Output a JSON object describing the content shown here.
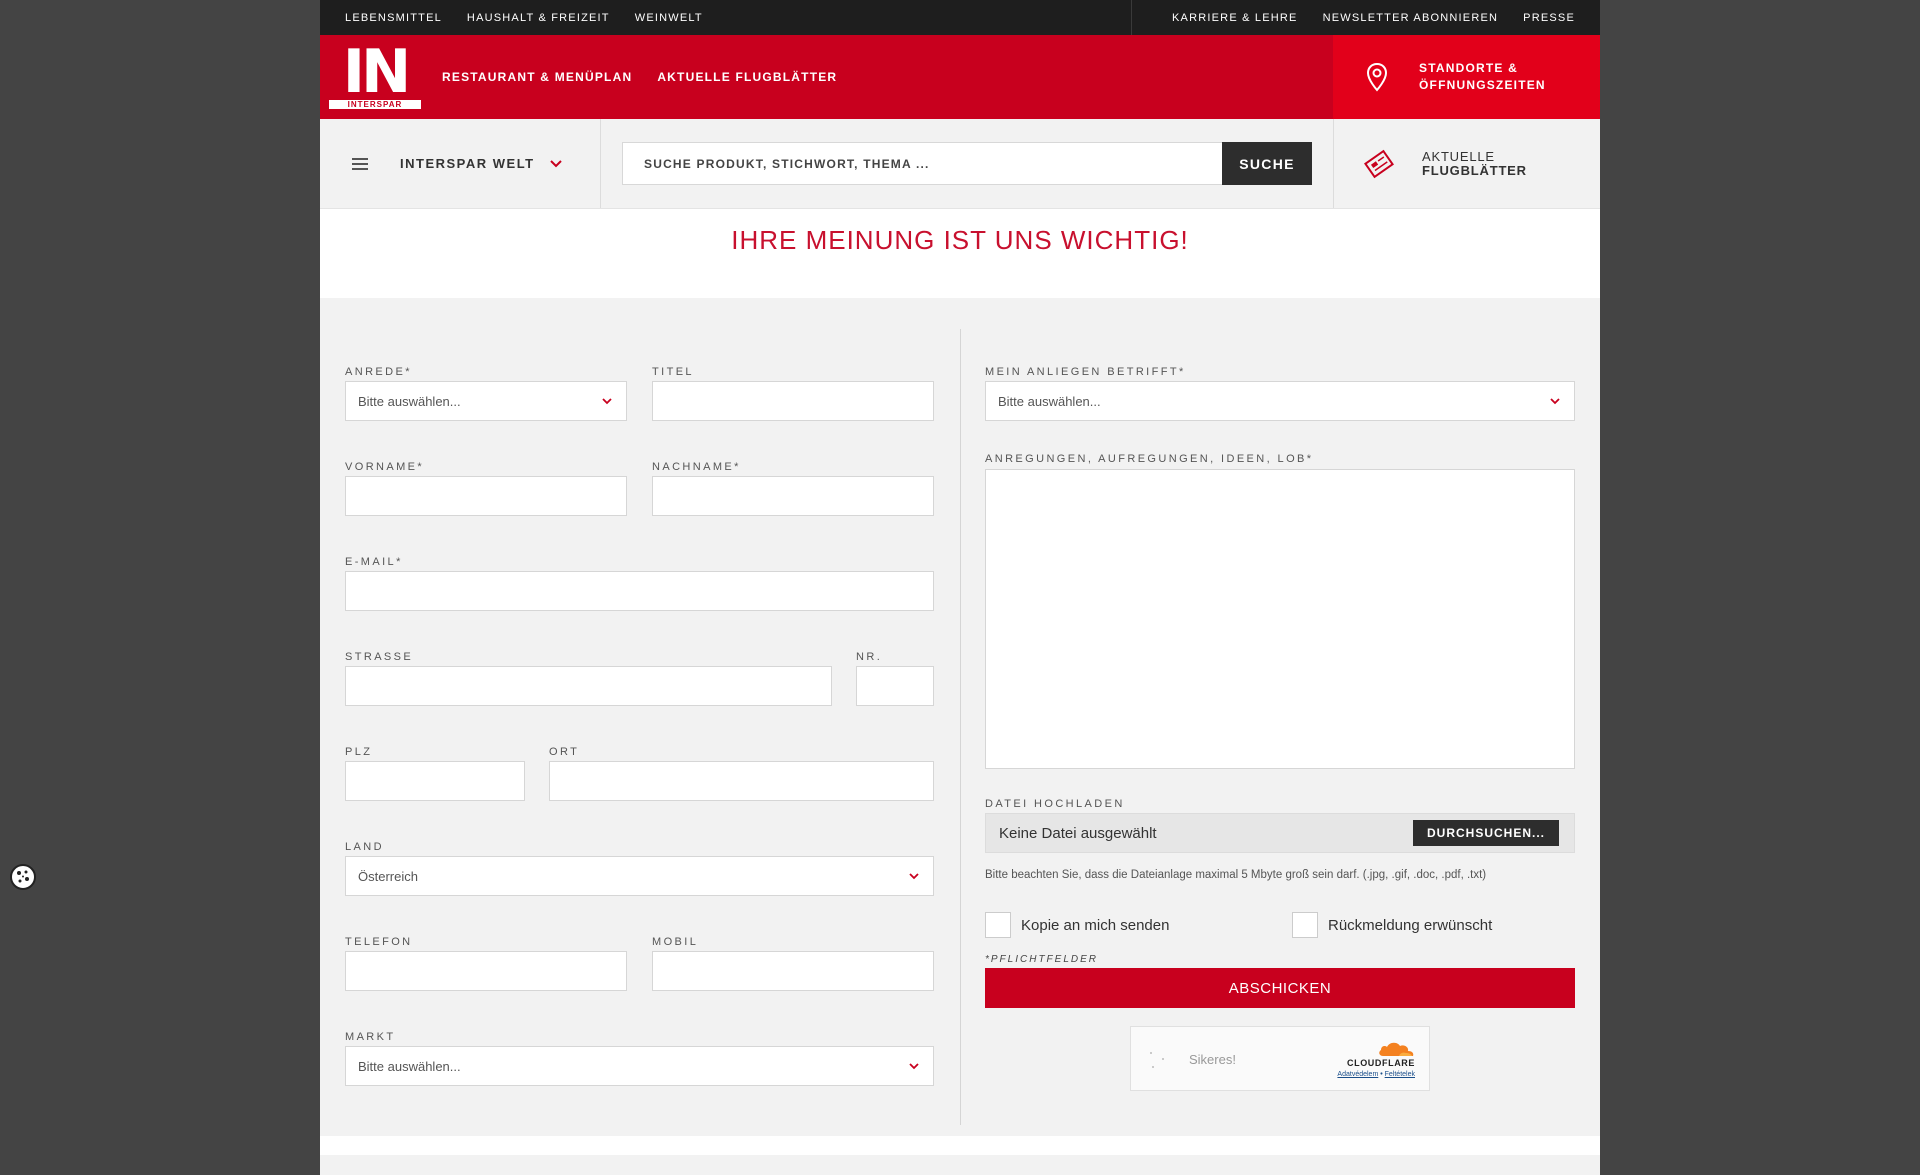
{
  "topbar": {
    "left_links": [
      "LEBENSMITTEL",
      "HAUSHALT & FREIZEIT",
      "WEINWELT"
    ],
    "right_links": [
      "KARRIERE & LEHRE",
      "NEWSLETTER ABONNIEREN",
      "PRESSE"
    ]
  },
  "header": {
    "logo_text": "IN",
    "logo_brand": "INTERSPAR",
    "nav": [
      "RESTAURANT & MENÜPLAN",
      "AKTUELLE FLUGBLÄTTER"
    ],
    "stores_line1": "STANDORTE &",
    "stores_line2": "ÖFFNUNGSZEITEN"
  },
  "searchrow": {
    "welt_label": "INTERSPAR WELT",
    "search_placeholder": "SUCHE PRODUKT, STICHWORT, THEMA ...",
    "search_button": "SUCHE",
    "flyer_line1": "AKTUELLE",
    "flyer_line2": "FLUGBLÄTTER"
  },
  "page_title": "IHRE MEINUNG IST UNS WICHTIG!",
  "form": {
    "anrede_label": "ANREDE*",
    "anrede_value": "Bitte auswählen...",
    "titel_label": "TITEL",
    "vorname_label": "VORNAME*",
    "nachname_label": "NACHNAME*",
    "email_label": "E-MAIL*",
    "strasse_label": "STRASSE",
    "nr_label": "NR.",
    "plz_label": "PLZ",
    "ort_label": "ORT",
    "land_label": "LAND",
    "land_value": "Österreich",
    "telefon_label": "TELEFON",
    "mobil_label": "MOBIL",
    "markt_label": "MARKT",
    "markt_value": "Bitte auswählen...",
    "anliegen_label": "MEIN ANLIEGEN BETRIFFT*",
    "anliegen_value": "Bitte auswählen...",
    "anregungen_label": "ANREGUNGEN, AUFREGUNGEN, IDEEN, LOB*",
    "upload_label": "DATEI HOCHLADEN",
    "upload_value": "Keine Datei ausgewählt",
    "upload_button": "DURCHSUCHEN...",
    "upload_note": "Bitte beachten Sie, dass die Dateianlage maximal 5 Mbyte groß sein darf. (.jpg, .gif, .doc, .pdf, .txt)",
    "kopie_label": "Kopie an mich senden",
    "rueckmeldung_label": "Rückmeldung erwünscht",
    "pflicht_note": "*PFLICHTFELDER",
    "submit_label": "ABSCHICKEN"
  },
  "captcha": {
    "status": "Sikeres!",
    "provider": "CLOUDFLARE",
    "privacy": "Adatvédelem",
    "separator": "•",
    "terms": "Feltételek"
  },
  "colors": {
    "brand_red": "#c8001e",
    "title_red": "#c8102e",
    "dark": "#2d2d2d"
  }
}
